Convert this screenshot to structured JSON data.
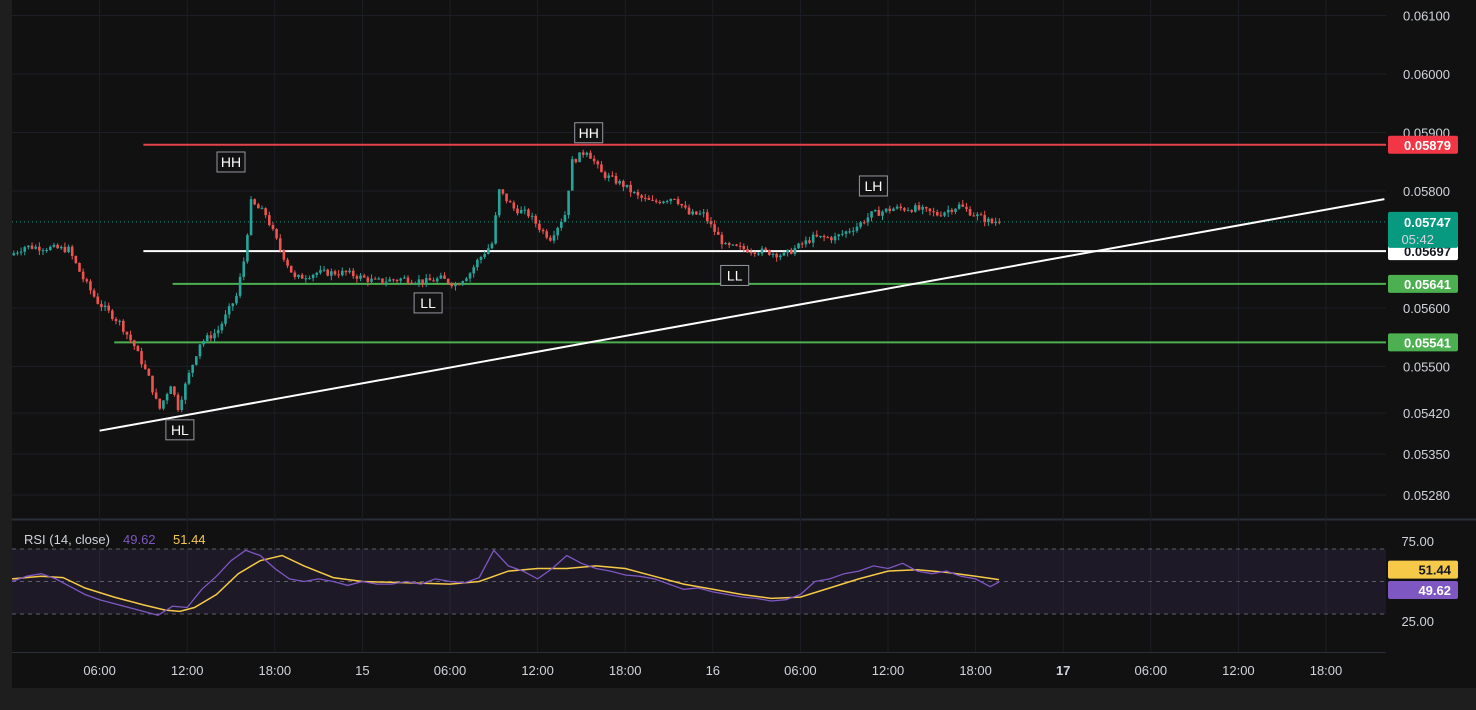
{
  "chart_data": {
    "type": "candlestick",
    "price_axis": {
      "ticks": [
        "0.06100",
        "0.06000",
        "0.05900",
        "0.05800",
        "0.05600",
        "0.05500",
        "0.05420",
        "0.05350",
        "0.05280"
      ],
      "tick_values": [
        0.061,
        0.06,
        0.059,
        0.058,
        0.056,
        0.055,
        0.0542,
        0.0535,
        0.0528
      ]
    },
    "time_axis": {
      "labels": [
        "06:00",
        "12:00",
        "18:00",
        "15",
        "06:00",
        "12:00",
        "18:00",
        "16",
        "06:00",
        "12:00",
        "18:00",
        "17",
        "06:00",
        "12:00",
        "18:00"
      ],
      "hours": [
        6,
        12,
        18,
        24,
        30,
        36,
        42,
        48,
        54,
        60,
        66,
        72,
        78,
        84,
        90
      ],
      "bold": [
        false,
        false,
        false,
        false,
        false,
        false,
        false,
        false,
        false,
        false,
        false,
        true,
        false,
        false,
        false
      ]
    },
    "price_path": [
      [
        0.0,
        0.0569
      ],
      [
        1.0,
        0.05705
      ],
      [
        3.0,
        0.05702
      ],
      [
        4.0,
        0.057
      ],
      [
        5.0,
        0.0565
      ],
      [
        6.0,
        0.0561
      ],
      [
        7.5,
        0.05575
      ],
      [
        8.5,
        0.05535
      ],
      [
        9.5,
        0.0548
      ],
      [
        10.2,
        0.05425
      ],
      [
        11.0,
        0.0547
      ],
      [
        11.5,
        0.0543
      ],
      [
        12.3,
        0.0549
      ],
      [
        13.0,
        0.0554
      ],
      [
        14.2,
        0.0556
      ],
      [
        15.5,
        0.0562
      ],
      [
        16.0,
        0.0568
      ],
      [
        16.5,
        0.0578
      ],
      [
        17.5,
        0.0576
      ],
      [
        18.5,
        0.057
      ],
      [
        19.5,
        0.0565
      ],
      [
        21.0,
        0.0566
      ],
      [
        23.0,
        0.0566
      ],
      [
        25.0,
        0.05645
      ],
      [
        27.0,
        0.0565
      ],
      [
        28.5,
        0.05645
      ],
      [
        29.5,
        0.0565
      ],
      [
        30.5,
        0.0564
      ],
      [
        31.5,
        0.0566
      ],
      [
        32.0,
        0.0568
      ],
      [
        33.0,
        0.0571
      ],
      [
        33.5,
        0.058
      ],
      [
        34.5,
        0.0577
      ],
      [
        35.5,
        0.0576
      ],
      [
        36.5,
        0.0573
      ],
      [
        37.0,
        0.0572
      ],
      [
        38.0,
        0.0576
      ],
      [
        38.5,
        0.0585
      ],
      [
        39.5,
        0.0587
      ],
      [
        40.5,
        0.0583
      ],
      [
        42.0,
        0.0581
      ],
      [
        43.0,
        0.0579
      ],
      [
        44.0,
        0.0578
      ],
      [
        45.5,
        0.0579
      ],
      [
        46.5,
        0.0576
      ],
      [
        47.5,
        0.0576
      ],
      [
        48.0,
        0.0574
      ],
      [
        49.0,
        0.05705
      ],
      [
        50.5,
        0.057
      ],
      [
        52.0,
        0.05695
      ],
      [
        53.0,
        0.0569
      ],
      [
        54.0,
        0.05705
      ],
      [
        55.0,
        0.0572
      ],
      [
        56.5,
        0.0572
      ],
      [
        58.0,
        0.0574
      ],
      [
        59.0,
        0.0576
      ],
      [
        60.5,
        0.0577
      ],
      [
        62.0,
        0.0577
      ],
      [
        63.5,
        0.0576
      ],
      [
        65.0,
        0.05775
      ],
      [
        66.0,
        0.0576
      ],
      [
        67.3,
        0.05745
      ],
      [
        67.6,
        0.0575
      ]
    ],
    "horizontal_levels": [
      {
        "name": "resistance-top",
        "value": 0.05879,
        "label": "0.05879",
        "color": "#f23645",
        "line_color": "#e5434b",
        "text_color": "#ffffff",
        "from_hour": 9.0
      },
      {
        "name": "white-level",
        "value": 0.05697,
        "label": "0.05697",
        "color": "#ffffff",
        "line_color": "#ffffff",
        "text_color": "#131722",
        "from_hour": 9.0
      },
      {
        "name": "support-upper",
        "value": 0.05641,
        "label": "0.05641",
        "color": "#4caf50",
        "line_color": "#4caf50",
        "text_color": "#ffffff",
        "from_hour": 11.0
      },
      {
        "name": "support-lower",
        "value": 0.05541,
        "label": "0.05541",
        "color": "#4caf50",
        "line_color": "#4caf50",
        "text_color": "#ffffff",
        "from_hour": 7.0
      }
    ],
    "current_price": {
      "label": "0.05747",
      "countdown": "05:42",
      "value": 0.05747,
      "color": "#089981"
    },
    "trendline": {
      "from": [
        6.0,
        0.0539
      ],
      "to": [
        94.0,
        0.05786
      ],
      "color": "#ffffff"
    },
    "annotations": [
      {
        "text": "HH",
        "hour": 15.0,
        "value": 0.05829,
        "pos": "above"
      },
      {
        "text": "HH",
        "hour": 39.5,
        "value": 0.05879,
        "pos": "above"
      },
      {
        "text": "LH",
        "hour": 59.0,
        "value": 0.05788,
        "pos": "above"
      },
      {
        "text": "LL",
        "hour": 28.5,
        "value": 0.05629,
        "pos": "below"
      },
      {
        "text": "LL",
        "hour": 49.5,
        "value": 0.05676,
        "pos": "below"
      },
      {
        "text": "HL",
        "hour": 11.5,
        "value": 0.05412,
        "pos": "below"
      }
    ],
    "rsi": {
      "legend_label": "RSI (14, close)",
      "rsi_value": "49.62",
      "ma_value": "51.44",
      "rsi_color": "#7e57c2",
      "ma_color": "#f7c948",
      "band_upper": "75.00",
      "band_lower": "25.00",
      "band_upper_value": 75,
      "band_lower_value": 25,
      "middle_value": 50,
      "rsi_path": [
        [
          0,
          50
        ],
        [
          1,
          54
        ],
        [
          2,
          56
        ],
        [
          3,
          52
        ],
        [
          4,
          46
        ],
        [
          5,
          40
        ],
        [
          6,
          36
        ],
        [
          7,
          33
        ],
        [
          8,
          30
        ],
        [
          9,
          27
        ],
        [
          10,
          24
        ],
        [
          11,
          31
        ],
        [
          12,
          30
        ],
        [
          13,
          44
        ],
        [
          14,
          54
        ],
        [
          15,
          66
        ],
        [
          16,
          74
        ],
        [
          17,
          70
        ],
        [
          18,
          60
        ],
        [
          19,
          52
        ],
        [
          20,
          50
        ],
        [
          21,
          52
        ],
        [
          22,
          50
        ],
        [
          23,
          47
        ],
        [
          24,
          50
        ],
        [
          25,
          48
        ],
        [
          26,
          48
        ],
        [
          27,
          50
        ],
        [
          28,
          48
        ],
        [
          29,
          52
        ],
        [
          30,
          50
        ],
        [
          31,
          49
        ],
        [
          32,
          53
        ],
        [
          33,
          74
        ],
        [
          34,
          62
        ],
        [
          35,
          58
        ],
        [
          36,
          52
        ],
        [
          37,
          60
        ],
        [
          38,
          70
        ],
        [
          39,
          64
        ],
        [
          40,
          60
        ],
        [
          41,
          58
        ],
        [
          42,
          55
        ],
        [
          43,
          54
        ],
        [
          44,
          52
        ],
        [
          45,
          48
        ],
        [
          46,
          44
        ],
        [
          47,
          45
        ],
        [
          48,
          42
        ],
        [
          49,
          40
        ],
        [
          50,
          38
        ],
        [
          51,
          37
        ],
        [
          52,
          35
        ],
        [
          53,
          36
        ],
        [
          54,
          40
        ],
        [
          55,
          50
        ],
        [
          56,
          52
        ],
        [
          57,
          56
        ],
        [
          58,
          58
        ],
        [
          59,
          62
        ],
        [
          60,
          60
        ],
        [
          61,
          64
        ],
        [
          62,
          58
        ],
        [
          63,
          56
        ],
        [
          64,
          58
        ],
        [
          65,
          54
        ],
        [
          66,
          52
        ],
        [
          67,
          46
        ],
        [
          67.6,
          49.62
        ]
      ],
      "ma_path": [
        [
          0,
          52
        ],
        [
          2,
          54
        ],
        [
          3.5,
          53
        ],
        [
          5,
          45
        ],
        [
          7,
          38
        ],
        [
          9,
          32
        ],
        [
          10.5,
          28
        ],
        [
          11.5,
          27
        ],
        [
          12.5,
          30
        ],
        [
          14,
          40
        ],
        [
          15.5,
          56
        ],
        [
          17,
          66
        ],
        [
          18.5,
          70
        ],
        [
          20,
          62
        ],
        [
          22,
          53
        ],
        [
          24,
          50
        ],
        [
          27,
          49
        ],
        [
          30,
          48
        ],
        [
          32,
          50
        ],
        [
          34,
          58
        ],
        [
          36,
          60
        ],
        [
          38,
          60
        ],
        [
          40,
          62
        ],
        [
          42,
          60
        ],
        [
          44,
          54
        ],
        [
          46,
          48
        ],
        [
          48,
          44
        ],
        [
          50,
          40
        ],
        [
          52,
          37
        ],
        [
          54,
          38
        ],
        [
          56,
          45
        ],
        [
          58,
          52
        ],
        [
          60,
          58
        ],
        [
          62,
          59
        ],
        [
          64,
          57
        ],
        [
          66,
          54
        ],
        [
          67.6,
          51.44
        ]
      ]
    }
  }
}
